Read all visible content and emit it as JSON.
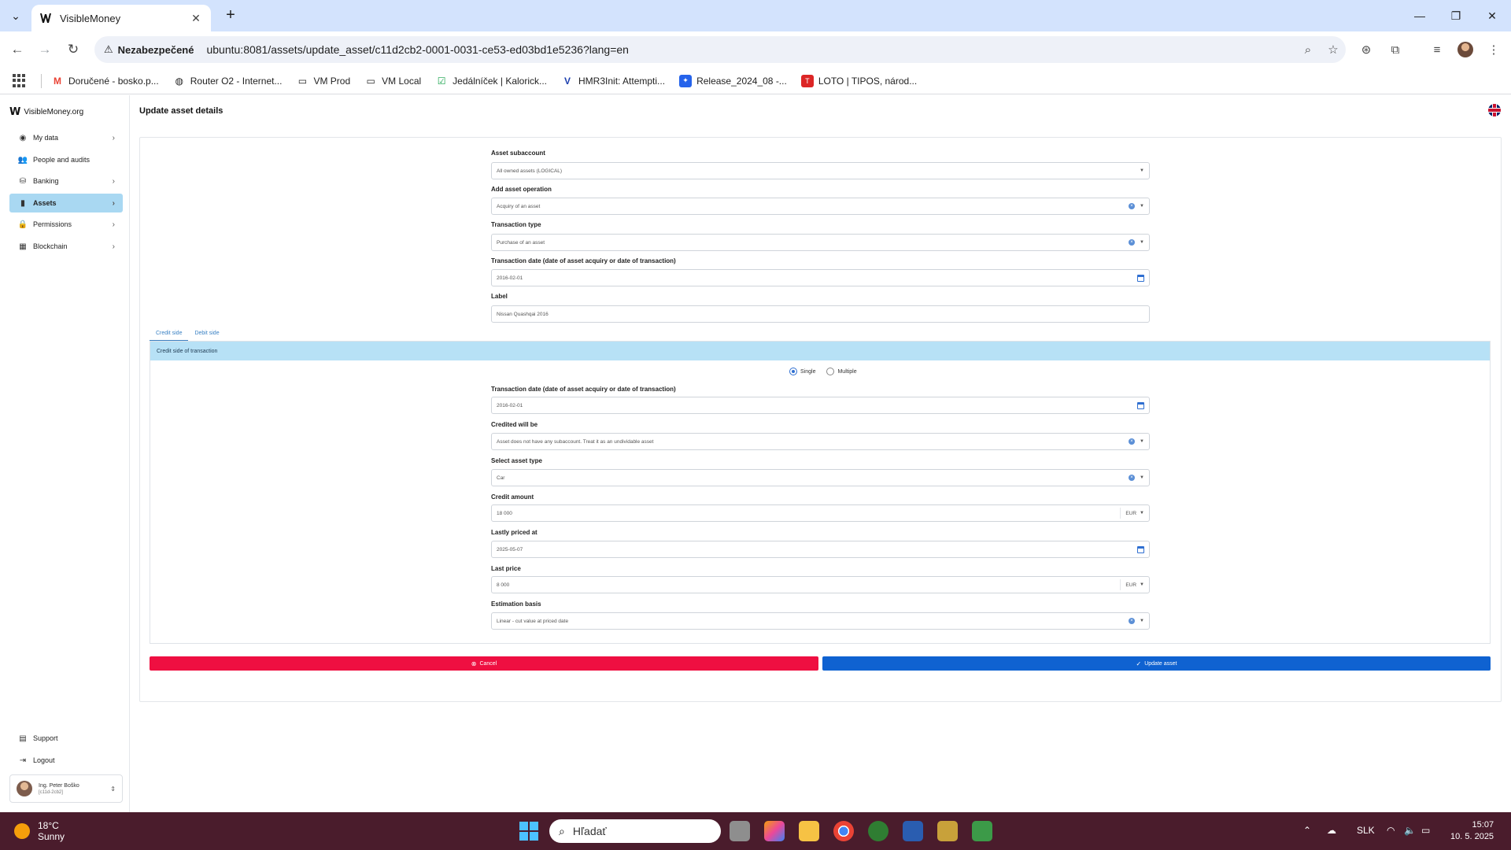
{
  "browser": {
    "tab_title": "VisibleMoney",
    "security_label": "Nezabezpečené",
    "url": "ubuntu:8081/assets/update_asset/c11d2cb2-0001-0031-ce53-ed03bd1e5236?lang=en",
    "bookmarks": [
      {
        "label": "Doručené - bosko.p...",
        "icon": "gmail-icon"
      },
      {
        "label": "Router O2 - Internet...",
        "icon": "globe-icon"
      },
      {
        "label": "VM Prod",
        "icon": "folder-icon"
      },
      {
        "label": "VM Local",
        "icon": "folder-icon"
      },
      {
        "label": "Jedálníček | Kalorick...",
        "icon": "checkbox-icon"
      },
      {
        "label": "HMR3Init: Attempti...",
        "icon": "vs-icon"
      },
      {
        "label": "Release_2024_08 -...",
        "icon": "jira-icon"
      },
      {
        "label": "LOTO | TIPOS, národ...",
        "icon": "tipos-icon"
      }
    ]
  },
  "app": {
    "logo_text": "VisibleMoney.org",
    "nav": [
      {
        "label": "My data",
        "icon": "person-circle-icon",
        "chevron": true
      },
      {
        "label": "People and audits",
        "icon": "people-icon",
        "chevron": false
      },
      {
        "label": "Banking",
        "icon": "bank-icon",
        "chevron": true
      },
      {
        "label": "Assets",
        "icon": "bar-chart-icon",
        "chevron": true,
        "active": true
      },
      {
        "label": "Permissions",
        "icon": "lock-icon",
        "chevron": true
      },
      {
        "label": "Blockchain",
        "icon": "blocks-icon",
        "chevron": true
      }
    ],
    "support_label": "Support",
    "logout_label": "Logout",
    "user": {
      "name": "Ing. Peter Boško",
      "id": "[c11d-2cb2]"
    }
  },
  "page": {
    "title": "Update asset details",
    "header_fields": [
      {
        "label": "Asset subaccount",
        "value": "All owned assets (LOGICAL)",
        "control": "select"
      },
      {
        "label": "Add asset operation",
        "value": "Acquiry of an asset",
        "control": "select-clear"
      },
      {
        "label": "Transaction type",
        "value": "Purchase of an asset",
        "control": "select-clear"
      },
      {
        "label": "Transaction date (date of asset acquiry or date of transaction)",
        "value": "2016-02-01",
        "control": "date"
      },
      {
        "label": "Label",
        "value": "Nissan Quashqai 2016",
        "control": "text"
      }
    ],
    "tabs": [
      "Credit side",
      "Debit side"
    ],
    "section_title": "Credit side of transaction",
    "radio_options": [
      "Single",
      "Multiple"
    ],
    "radio_selected": "Single",
    "credit_fields": [
      {
        "label": "Transaction date (date of asset acquiry or date of transaction)",
        "value": "2016-02-01",
        "control": "date"
      },
      {
        "label": "Credited will be",
        "value": "Asset does not have any subaccount. Treat it as an undividable asset",
        "control": "select-clear"
      },
      {
        "label": "Select asset type",
        "value": "Car",
        "control": "select-clear"
      },
      {
        "label": "Credit amount",
        "value": "18 000",
        "control": "currency",
        "currency": "EUR"
      },
      {
        "label": "Lastly priced at",
        "value": "2025-05-07",
        "control": "date"
      },
      {
        "label": "Last price",
        "value": "8 000",
        "control": "currency",
        "currency": "EUR"
      },
      {
        "label": "Estimation basis",
        "value": "Linear - cut value at priced date",
        "control": "select-clear"
      }
    ],
    "cancel_label": "Cancel",
    "update_label": "Update asset"
  },
  "taskbar": {
    "temperature": "18°C",
    "weather": "Sunny",
    "search_placeholder": "Hľadať",
    "language": "SLK",
    "time": "15:07",
    "date": "10. 5. 2025"
  },
  "colors": {
    "accent": "#0f62d1",
    "cancel": "#ef0f41",
    "active_nav": "#a9d8f2",
    "section_banner": "#b7e1f6",
    "taskbar": "#4a1c2c"
  }
}
